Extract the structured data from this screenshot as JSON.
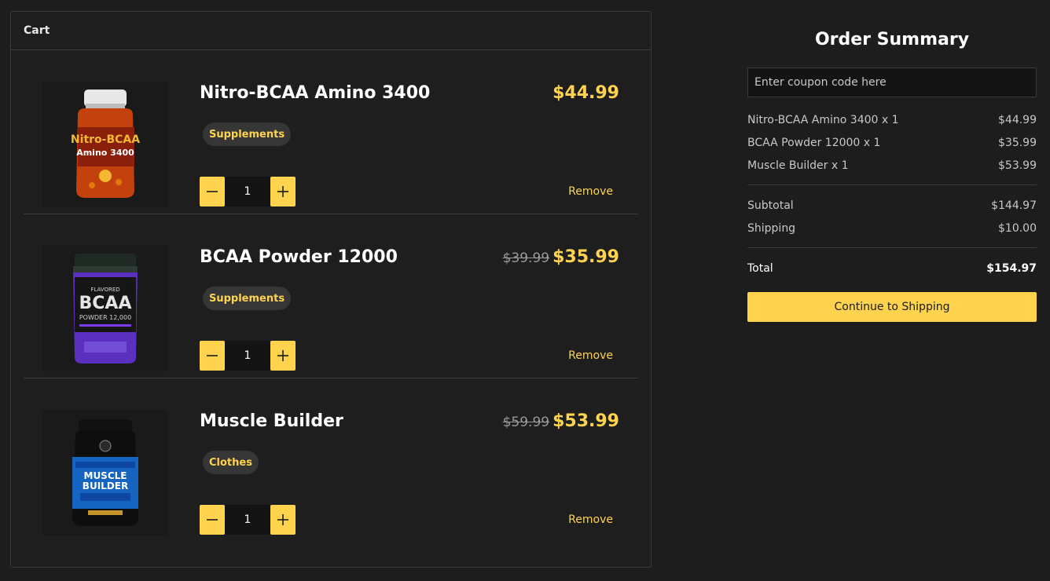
{
  "cart": {
    "title": "Cart",
    "items": [
      {
        "name": "Nitro-BCAA Amino 3400",
        "old_price": "",
        "price": "$44.99",
        "category": "Supplements",
        "quantity": "1",
        "remove_label": "Remove",
        "image_icon": "supplement-bottle-orange"
      },
      {
        "name": "BCAA Powder 12000",
        "old_price": "$39.99",
        "price": "$35.99",
        "category": "Supplements",
        "quantity": "1",
        "remove_label": "Remove",
        "image_icon": "supplement-tub-purple"
      },
      {
        "name": "Muscle Builder",
        "old_price": "$59.99",
        "price": "$53.99",
        "category": "Clothes",
        "quantity": "1",
        "remove_label": "Remove",
        "image_icon": "supplement-tub-blue"
      }
    ]
  },
  "summary": {
    "title": "Order Summary",
    "coupon_placeholder": "Enter coupon code here",
    "lines": [
      {
        "label": "Nitro-BCAA Amino 3400 x 1",
        "value": "$44.99"
      },
      {
        "label": "BCAA Powder 12000 x 1",
        "value": "$35.99"
      },
      {
        "label": "Muscle Builder x 1",
        "value": "$53.99"
      }
    ],
    "subtotal_label": "Subtotal",
    "subtotal_value": "$144.97",
    "shipping_label": "Shipping",
    "shipping_value": "$10.00",
    "total_label": "Total",
    "total_value": "$154.97",
    "cta_label": "Continue to Shipping"
  },
  "colors": {
    "accent": "#ffd34e",
    "background": "#1d1d1d",
    "panel_border": "#3b3b3b"
  }
}
